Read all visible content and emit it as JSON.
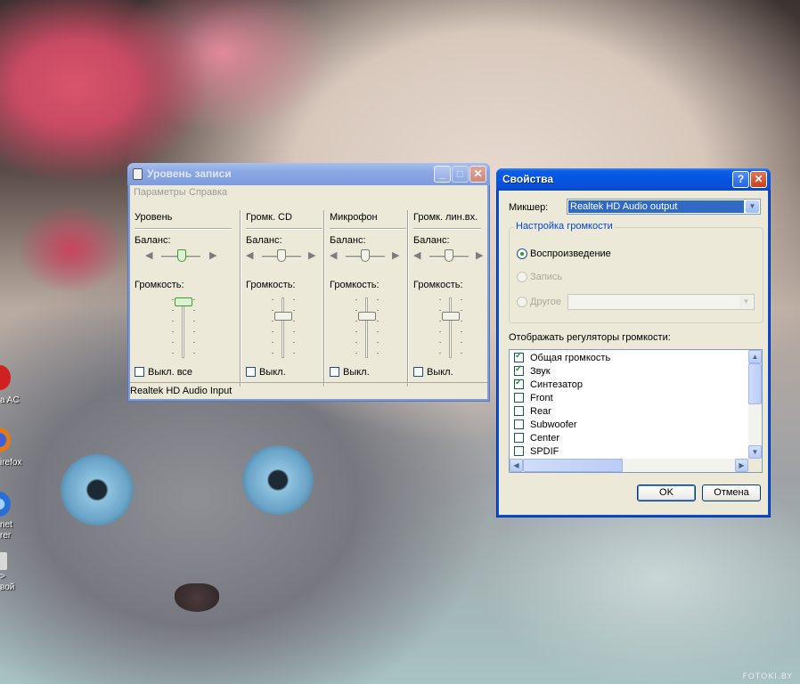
{
  "desktop": {
    "icons": [
      {
        "label": "a AC",
        "color": "#d02020"
      },
      {
        "label": "irefox",
        "color": "#e07a1a"
      },
      {
        "label": "net\nrer",
        "color": "#2a6fd6"
      },
      {
        "label": ">\nвой",
        "color": "#d0d0d0"
      }
    ],
    "watermark": "FOTOKI.BY"
  },
  "level_window": {
    "title": "Уровень записи",
    "menu": [
      "Параметры",
      "Справка"
    ],
    "columns": [
      {
        "title": "Уровень",
        "balance_label": "Баланс:",
        "volume_label": "Громкость:",
        "mute_label": "Выкл. все",
        "muted": false,
        "balance": 0.5,
        "volume": 1.0
      },
      {
        "title": "Громк. CD",
        "balance_label": "Баланс:",
        "volume_label": "Громкость:",
        "mute_label": "Выкл.",
        "muted": false,
        "balance": 0.5,
        "volume": 0.75
      },
      {
        "title": "Микрофон",
        "balance_label": "Баланс:",
        "volume_label": "Громкость:",
        "mute_label": "Выкл.",
        "muted": false,
        "balance": 0.5,
        "volume": 0.75
      },
      {
        "title": "Громк. лин.вх.",
        "balance_label": "Баланс:",
        "volume_label": "Громкость:",
        "mute_label": "Выкл.",
        "muted": false,
        "balance": 0.5,
        "volume": 0.75
      }
    ],
    "status": "Realtek HD Audio Input"
  },
  "props_window": {
    "title": "Свойства",
    "help_btn": "?",
    "mixer_label": "Микшер:",
    "mixer_value": "Realtek HD Audio output",
    "group_title": "Настройка громкости",
    "radios": [
      {
        "label": "Воспроизведение",
        "selected": true,
        "enabled": true
      },
      {
        "label": "Запись",
        "selected": false,
        "enabled": false
      },
      {
        "label": "Другое",
        "selected": false,
        "enabled": false
      }
    ],
    "list_title": "Отображать регуляторы громкости:",
    "list_items": [
      {
        "label": "Общая громкость",
        "checked": true
      },
      {
        "label": "Звук",
        "checked": true
      },
      {
        "label": "Синтезатор",
        "checked": true
      },
      {
        "label": "Front",
        "checked": false
      },
      {
        "label": "Rear",
        "checked": false
      },
      {
        "label": "Subwoofer",
        "checked": false
      },
      {
        "label": "Center",
        "checked": false
      },
      {
        "label": "SPDIF",
        "checked": false
      }
    ],
    "ok_label": "OK",
    "cancel_label": "Отмена"
  }
}
